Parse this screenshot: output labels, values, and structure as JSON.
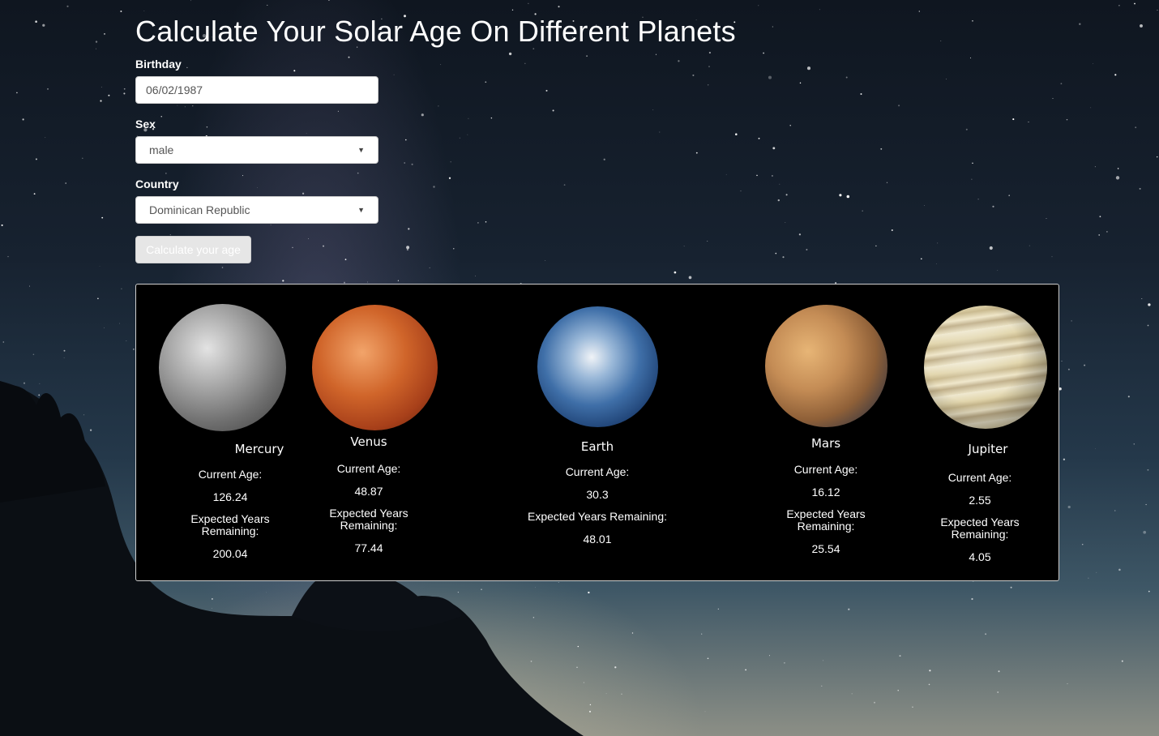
{
  "page": {
    "title": "Calculate Your Solar Age On Different Planets"
  },
  "form": {
    "birthday_label": "Birthday",
    "birthday_value": "06/02/1987",
    "sex_label": "Sex",
    "sex_value": "male",
    "country_label": "Country",
    "country_value": "Dominican Republic",
    "calculate_label": "Calculate your age"
  },
  "planets": [
    {
      "name": "Mercury",
      "current_label": "Current Age:",
      "current": "126.24",
      "remaining_label_1": "Expected Years",
      "remaining_label_2": "Remaining:",
      "remaining": "200.04"
    },
    {
      "name": "Venus",
      "current_label": "Current Age:",
      "current": "48.87",
      "remaining_label_1": "Expected Years",
      "remaining_label_2": "Remaining:",
      "remaining": "77.44"
    },
    {
      "name": "Earth",
      "current_label": "Current Age:",
      "current": "30.3",
      "remaining_label_1": "Expected Years Remaining:",
      "remaining": "48.01"
    },
    {
      "name": "Mars",
      "current_label": "Current Age:",
      "current": "16.12",
      "remaining_label_1": "Expected Years",
      "remaining_label_2": "Remaining:",
      "remaining": "25.54"
    },
    {
      "name": "Jupiter",
      "current_label": "Current Age:",
      "current": "2.55",
      "remaining_label_1": "Expected Years",
      "remaining_label_2": "Remaining:",
      "remaining": "4.05"
    }
  ],
  "colors": {
    "mercury": "#9a9a9a",
    "venus": "#c8551e",
    "earth": "#2f5d9a",
    "mars": "#b58352",
    "jupiter": "#d8cfb0"
  }
}
